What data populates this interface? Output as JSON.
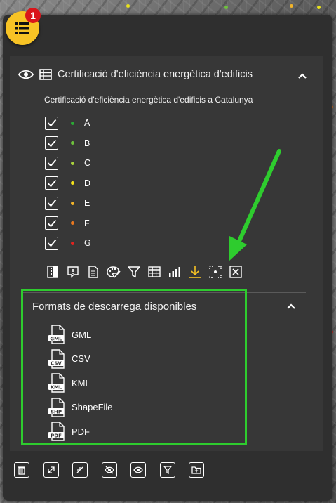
{
  "notification_badge": "1",
  "layer": {
    "title": "Certificació d'eficiència energètica d'edificis",
    "subtitle": "Certificació d'eficiència energètica d'edificis a Catalunya",
    "legend": [
      {
        "label": "A",
        "color": "#2aa835",
        "checked": true
      },
      {
        "label": "B",
        "color": "#6ec13c",
        "checked": true
      },
      {
        "label": "C",
        "color": "#a9d13c",
        "checked": true
      },
      {
        "label": "D",
        "color": "#f4e21a",
        "checked": true
      },
      {
        "label": "E",
        "color": "#f2b42a",
        "checked": true
      },
      {
        "label": "F",
        "color": "#e9781f",
        "checked": true
      },
      {
        "label": "G",
        "color": "#e2231f",
        "checked": true
      }
    ],
    "tools": [
      "opacity-icon",
      "info-icon",
      "document-icon",
      "palette-icon",
      "filter-icon",
      "table-icon",
      "chart-icon",
      "download-icon",
      "zoom-extent-icon",
      "close-icon"
    ]
  },
  "downloads": {
    "title": "Formats de descarrega disponibles",
    "formats": [
      {
        "name": "GML",
        "tag": "GML"
      },
      {
        "name": "CSV",
        "tag": "CSV"
      },
      {
        "name": "KML",
        "tag": "KML"
      },
      {
        "name": "ShapeFile",
        "tag": "SHP"
      },
      {
        "name": "PDF",
        "tag": "PDF"
      }
    ]
  },
  "colors": {
    "accent": "#f7c325",
    "highlight": "#2ecc2e",
    "panel": "#2f2f2f"
  }
}
